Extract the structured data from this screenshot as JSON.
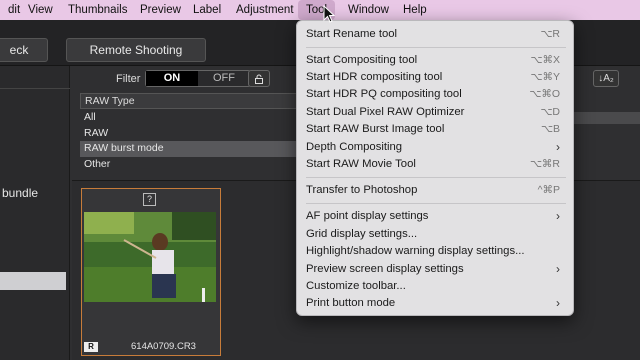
{
  "menubar": {
    "items": [
      "dit",
      "View",
      "Thumbnails",
      "Preview",
      "Label",
      "Adjustment",
      "Tool",
      "Window",
      "Help"
    ],
    "active": "Tool"
  },
  "toolbar": {
    "check_label": "eck",
    "remote_label": "Remote Shooting"
  },
  "filter": {
    "label": "Filter",
    "on": "ON",
    "off": "OFF",
    "lock_icon": "lock-icon",
    "sort_label": "↓A₂"
  },
  "raw_type": {
    "header": "RAW Type",
    "options": [
      "All",
      "RAW",
      "RAW burst mode",
      "Other"
    ],
    "selected": "RAW burst mode"
  },
  "sidebar": {
    "bundle_label": "bundle"
  },
  "thumbnail": {
    "question_mark": "?",
    "badge": "R",
    "filename": "614A0709.CR3",
    "selected_border_color": "#c77c3a"
  },
  "tool_menu": {
    "items": [
      {
        "label": "Start Rename tool",
        "shortcut": "⌥R"
      },
      {
        "label": "Start Compositing tool",
        "shortcut": "⌥⌘X"
      },
      {
        "label": "Start HDR compositing tool",
        "shortcut": "⌥⌘Y"
      },
      {
        "label": "Start HDR PQ compositing tool",
        "shortcut": "⌥⌘O"
      },
      {
        "label": "Start Dual Pixel RAW Optimizer",
        "shortcut": "⌥D"
      },
      {
        "label": "Start RAW Burst Image tool",
        "shortcut": "⌥B"
      },
      {
        "label": "Depth Compositing",
        "shortcut": "›"
      },
      {
        "label": "Start RAW Movie Tool",
        "shortcut": "⌥⌘R"
      },
      {
        "label": "Transfer to Photoshop",
        "shortcut": "^⌘P"
      },
      {
        "label": "AF point display settings",
        "shortcut": "›"
      },
      {
        "label": "Grid display settings...",
        "shortcut": ""
      },
      {
        "label": "Highlight/shadow warning display settings...",
        "shortcut": ""
      },
      {
        "label": "Preview screen display settings",
        "shortcut": "›"
      },
      {
        "label": "Customize toolbar...",
        "shortcut": ""
      },
      {
        "label": "Print button mode",
        "shortcut": "›"
      }
    ]
  },
  "colors": {
    "menubar_bg": "#e9c8e6",
    "menu_bg": "#e2e1e3",
    "app_bg": "#2f2f31"
  }
}
